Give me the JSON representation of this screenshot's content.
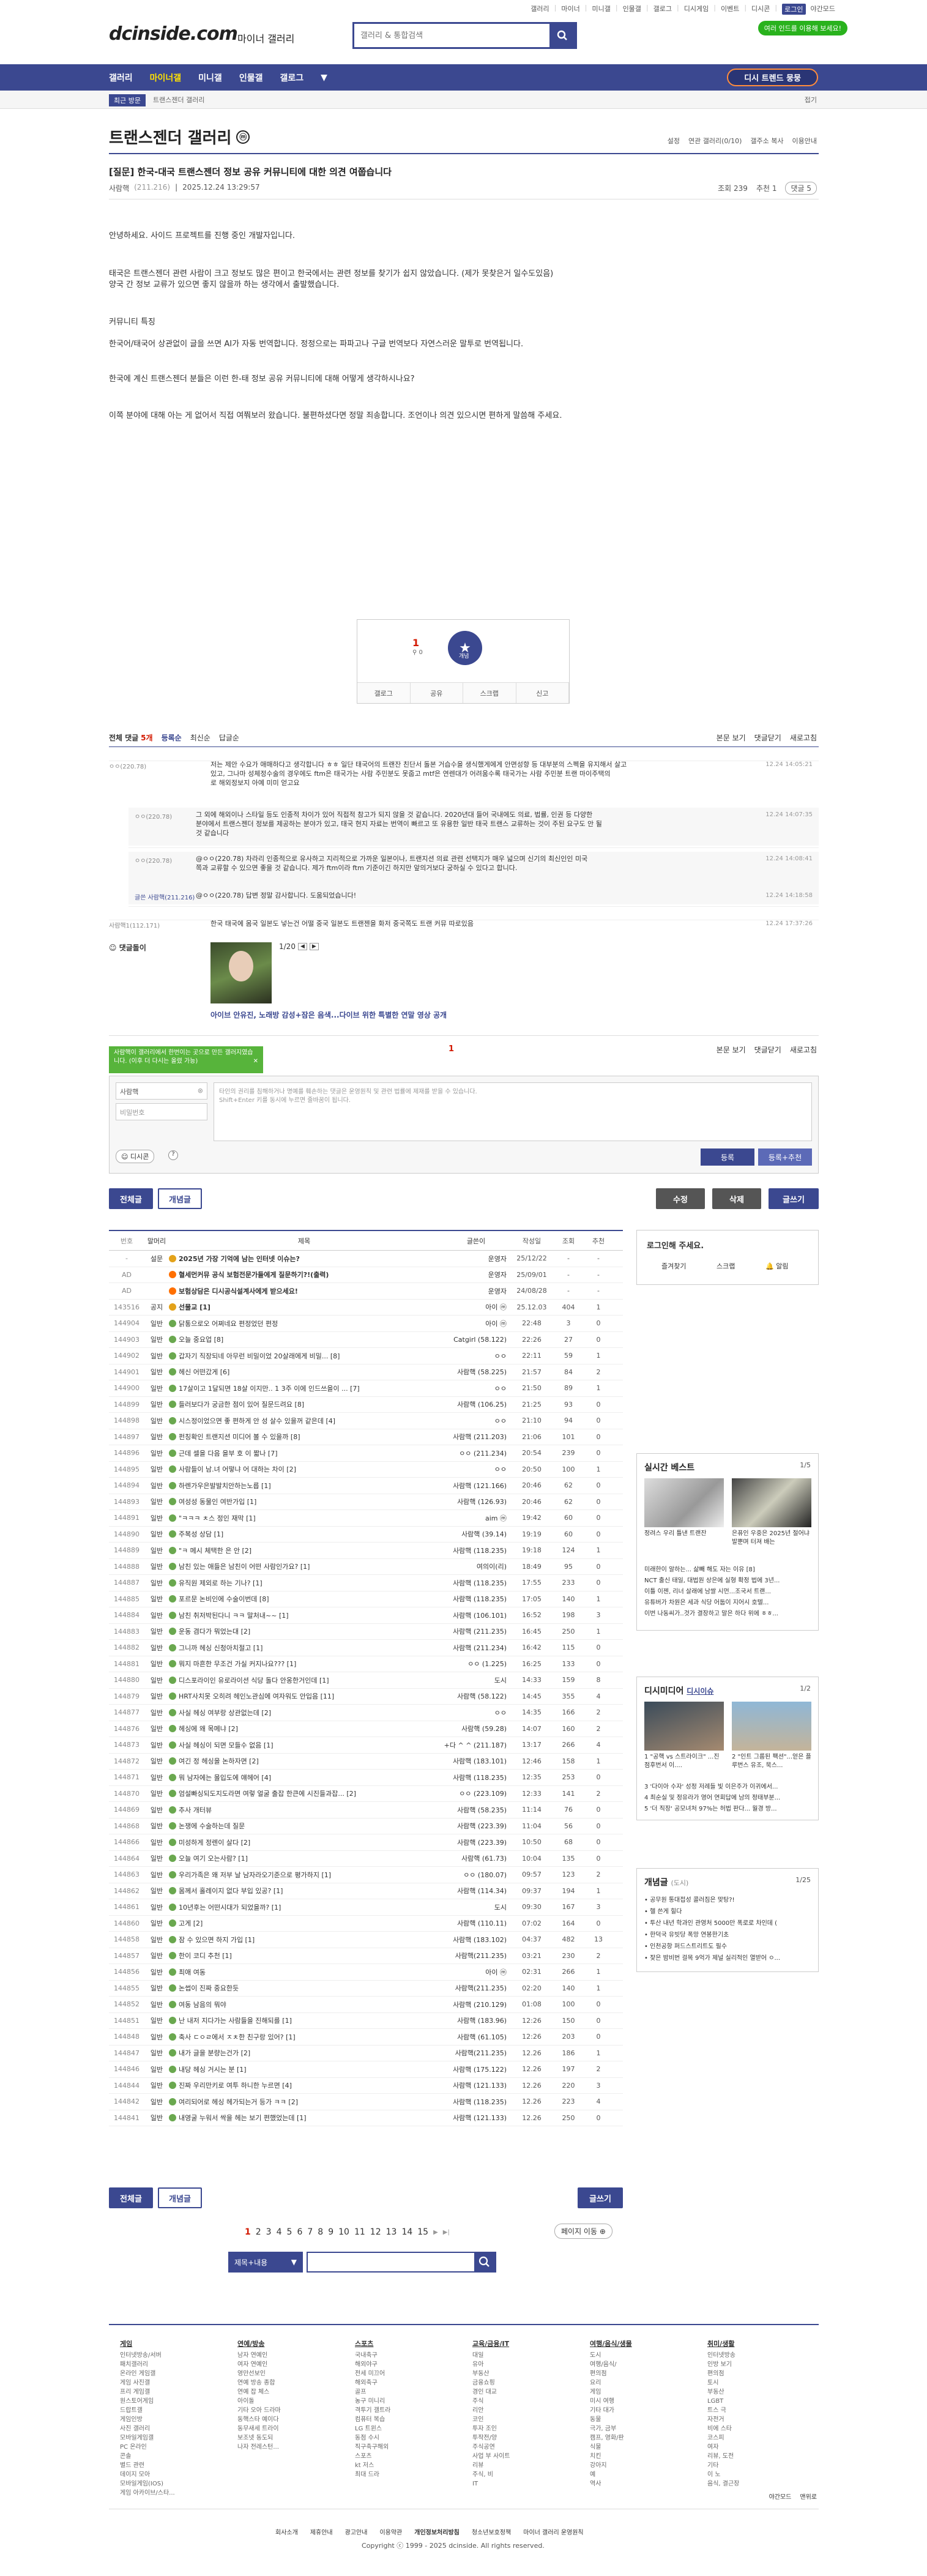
{
  "top_util": [
    "갤러리",
    "마이너",
    "미니갤",
    "인물갤",
    "갤로그",
    "디시게임",
    "이벤트",
    "디시콘",
    "로그인"
  ],
  "darkmode_label": "야간모드",
  "logo": "dcinside.com",
  "logo_sub": "마이너 갤러리",
  "search_placeholder": "갤러리 & 통합검색",
  "green_tag": "여러 인드를 이용해 보세요!",
  "gnb": {
    "items": [
      "갤러리",
      "마이너갤",
      "미니갤",
      "인물갤",
      "갤로그"
    ],
    "tree": "디시 트렌드 뭉뭉"
  },
  "subbar": {
    "recent": "최근 방문",
    "crumb": "트랜스젠더 갤러리",
    "fold": "접기"
  },
  "gallery": {
    "title": "트랜스젠더 갤러리",
    "badge": "ⓜ",
    "tools": [
      "설정",
      "연관 갤러리(0/10)",
      "갤주소 복사",
      "이용안내"
    ]
  },
  "post": {
    "title": "[질문] 한국-대국 트랜스젠더 정보 공유 커뮤니티에 대한 의견 여쭙습니다",
    "writer": "사람핵",
    "ip": "(211.216)",
    "date": "2025.12.24 13:29:57",
    "views": "조회 239",
    "recs": "추천 1",
    "comments": "댓글 5",
    "body": [
      "안녕하세요. 사이드 프로젝트를 진행 중인 개발자입니다.",
      "태국은 트랜스젠더 관련 사람이 크고 정보도 많은 편이고 한국에서는 관련 정보를 찾기가 쉽지 않았습니다. (제가 못찾은거 일수도있음)",
      "양국 간 정보 교류가 있으면 좋지 않을까 하는 생각에서 출발했습니다.",
      "커뮤니티 특징",
      "한국어/태국어 상관없이 글을 쓰면 AI가 자동 번역합니다. 정정으로는 파파고나 구글 번역보다 자연스러운 말투로 번역됩니다.",
      "한국에 계신 트랜스젠더 분들은 이런 한-태 정보 공유 커뮤니티에 대해 어떻게 생각하시나요?",
      "이쪽 분야에 대해 아는 게 없어서 직접 여쭤보러 왔습니다. 불편하셨다면 정말 죄송합니다. 조언이나 의견 있으시면 편하게 말씀해 주세요."
    ]
  },
  "reco": {
    "up": "1",
    "up_sub": "0",
    "star": "개념",
    "btns": [
      "갤로그",
      "공유",
      "스크랩",
      "신고"
    ]
  },
  "comment_head": {
    "all": "전체 댓글",
    "count": "5개",
    "opts": [
      "등록순",
      "최신순",
      "답글순"
    ],
    "right": [
      "본문 보기",
      "댓글닫기",
      "새로고침"
    ]
  },
  "comments": [
    {
      "nick": "ㅇㅇ(220.78)",
      "text": "저는 제안 수요가 애매하다고 생각합니다 ㅎㅎ 일단 태국어의 트랜잔 친단서 돌본 거습수을 생식했게에게 안면성향 등 대부분의 스펙을 유지해서 살고",
      "text2": "있고, 그나마 성체정수술의 경우에도 ftm은 태국가는 사람 주민분도 못줍고 mtf은 연렌대가 어려움수록 태국가는 사람 주민분 트랜 마이주택의",
      "text3": "로 해외정보지 아예 미미 얻고요",
      "date": "12.24 14:05:21"
    },
    {
      "nick": "ㅇㅇ(220.78)",
      "text": "그 외에 해외이나 스타일 등도 인종적 차이가 있어 직접적 참고가 되지 않을 것 같습니다. 2020년대 들어 국내에도 의료, 법률, 인권 등 다양한",
      "text2": "분야에서 트랜스젠더 정보를 제공하는 분야가 있고, 태국 현지 자료는 번역이 빠르고 또 유용한 일반 태국 트랜스 교류하는 것이 주된 요구도 안 될",
      "text3": "것 같습니다",
      "date": "12.24 14:07:35"
    },
    {
      "nick": "ㅇㅇ(220.78)",
      "text": "@ㅇㅇ(220.78) 차라리 인종적으로 유사하고 지리적으로 가까운 일본이나, 트랜지션 의료 관련 선택지가 매우 넓으며 신기의 최신인인 미국",
      "text2": "쪽과 교류할 수 있으면 좋을 것 같습니다. 제가 ftm이라 ftm 기준이긴 하지만 앞의거보다 궁하실 수 있다고 합니다.",
      "text3": "",
      "date": "12.24 14:08:41"
    },
    {
      "nick": "글쓴 사람핵(211.216)",
      "text": "@ㅇㅇ(220.78) 답변 정말 감사합니다. 도움되었습니다!",
      "text2": "",
      "text3": "",
      "date": "12.24 14:18:58"
    },
    {
      "nick": "사람핵1(112.171)",
      "text": "한국 태국에 몸국 일본도 넣는건 어떨 중국 일본도 트랜젠을 화저 중국쪽도 트랜 커뮤 따로있음",
      "text2": "",
      "text3": "",
      "date": "12.24 17:37:26"
    }
  ],
  "dccon": {
    "label": "댓글돌이",
    "page": "1/20",
    "caption": "아이브 안유진, 노래방 감성+잠은 음색...다이브 위한 특별한 연말 영상 공개"
  },
  "write": {
    "tip": "사람핵이 갤러리에서 한번이는 곳으로 만든 갤러지였습니다. (이후 더 다시는 올렸 가능)",
    "count": "1",
    "nick": "사람핵",
    "pw": "비밀번호",
    "placeholder1": "타인의 권리를 침해하거나 명예를 훼손하는 댓글은 운영원칙 및 관련 법률에 제재를 받을 수 있습니다.",
    "placeholder2": "Shift+Enter 키를 동시에 누르면 줄바꿈이 됩니다.",
    "dccon": "디시콘",
    "submit": "등록",
    "submit2": "등록+추천"
  },
  "actions": {
    "all": "전체글",
    "recommend": "개념글",
    "edit": "수정",
    "delete": "삭제",
    "write": "글쓰기"
  },
  "list_head": [
    "번호",
    "말머리",
    "제목",
    "글쓴이",
    "작성일",
    "조회",
    "추천"
  ],
  "list": [
    {
      "no": "-",
      "hd": "설문",
      "t": "2025년 가장 기억에 남는 인터넷 이슈는?",
      "w": "운영자",
      "d": "25/12/22",
      "v": "-",
      "r": "-",
      "type": "notice",
      "bold": true
    },
    {
      "no": "AD",
      "hd": "",
      "t": "혈세먼커뮤 공식 보험전문가들에게 질문하기?!(출력)",
      "w": "운영자",
      "d": "25/09/01",
      "v": "-",
      "r": "-",
      "type": "ad",
      "bold": true
    },
    {
      "no": "AD",
      "hd": "",
      "t": "보험상담은 디시공식설계사에게 받으세요!",
      "w": "운영자",
      "d": "24/08/28",
      "v": "-",
      "r": "-",
      "type": "ad",
      "bold": true
    },
    {
      "no": "143516",
      "hd": "공지",
      "t": "선물교 [1]",
      "w": "아이 ⓜ",
      "d": "25.12.03",
      "v": "404",
      "r": "1",
      "type": "notice",
      "bold": true
    },
    {
      "no": "144904",
      "hd": "일반",
      "t": "닭통으로오 어쩌네요 편정었던 편정",
      "w": "아이 ⓜ",
      "d": "22:48",
      "v": "3",
      "r": "0"
    },
    {
      "no": "144903",
      "hd": "일반",
      "t": "오늘 중요업 [8]",
      "w": "Catgirl (58.122)",
      "d": "22:26",
      "v": "27",
      "r": "0"
    },
    {
      "no": "144902",
      "hd": "일반",
      "t": "갑자기 직장되네 아무런 비밀이었 20살래에게 비밀... [8]",
      "w": "ㅇㅇ",
      "d": "22:11",
      "v": "59",
      "r": "1"
    },
    {
      "no": "144901",
      "hd": "일반",
      "t": "헤신 어떤갔게 [6]",
      "w": "사람핵 (58.225)",
      "d": "21:57",
      "v": "84",
      "r": "2"
    },
    {
      "no": "144900",
      "hd": "일반",
      "t": "17살이고 1달되면 18살 이지만.. 1 3주 이에 인드쓰을이 ... [7]",
      "w": "ㅇㅇ",
      "d": "21:50",
      "v": "89",
      "r": "1"
    },
    {
      "no": "144899",
      "hd": "일반",
      "t": "들러보다가 궁금한 점이 있어 질문드려요 [8]",
      "w": "사람핵 (106.25)",
      "d": "21:25",
      "v": "93",
      "r": "0"
    },
    {
      "no": "144898",
      "hd": "일반",
      "t": "시스정이었으면 좋 편하게 안 성 살수 있을꺼 같은데 [4]",
      "w": "ㅇㅇ",
      "d": "21:10",
      "v": "94",
      "r": "0"
    },
    {
      "no": "144897",
      "hd": "일반",
      "t": "펀칭확인 트랜지션 미디어 볼 수 있을까 [8]",
      "w": "사람핵 (211.203)",
      "d": "21:06",
      "v": "101",
      "r": "0"
    },
    {
      "no": "144896",
      "hd": "일반",
      "t": "근데 셀을 다음 을부 호 이 짧나 [7]",
      "w": "ㅇㅇ (211.234)",
      "d": "20:54",
      "v": "239",
      "r": "0"
    },
    {
      "no": "144895",
      "hd": "일반",
      "t": "사람들이 남.녀 어떻냐 어 대하는 차이 [2]",
      "w": "ㅇㅇ",
      "d": "20:50",
      "v": "100",
      "r": "1"
    },
    {
      "no": "144894",
      "hd": "일반",
      "t": "하렌가우은발발치안하는노릅 [1]",
      "w": "사람핵 (121.166)",
      "d": "20:46",
      "v": "62",
      "r": "0"
    },
    {
      "no": "144893",
      "hd": "일반",
      "t": "여성성 동물인 여반가입 [1]",
      "w": "사람핵 (126.93)",
      "d": "20:46",
      "v": "62",
      "r": "0"
    },
    {
      "no": "144891",
      "hd": "일반",
      "t": "\"ㅋㅋㅋ ㅊ스 정인 재막 [1]",
      "w": "aim ⓜ",
      "d": "19:42",
      "v": "60",
      "r": "0"
    },
    {
      "no": "144890",
      "hd": "일반",
      "t": "주복성 상담 [1]",
      "w": "사람핵 (39.14)",
      "d": "19:19",
      "v": "60",
      "r": "0"
    },
    {
      "no": "144889",
      "hd": "일반",
      "t": "\"ㅋ 메시 체택한 은 안 [2]",
      "w": "사람핵 (118.235)",
      "d": "19:18",
      "v": "124",
      "r": "1"
    },
    {
      "no": "144888",
      "hd": "일반",
      "t": "남친 있는 애들은 남친이 어떤 사람인가요? [1]",
      "w": "여의이(리)",
      "d": "18:49",
      "v": "95",
      "r": "0"
    },
    {
      "no": "144887",
      "hd": "일반",
      "t": "유직원 제외로 하는 기나? [1]",
      "w": "사람핵 (118.235)",
      "d": "17:55",
      "v": "233",
      "r": "0"
    },
    {
      "no": "144885",
      "hd": "일반",
      "t": "포르문 논비인에 수술이번데 [8]",
      "w": "사람핵 (118.235)",
      "d": "17:05",
      "v": "140",
      "r": "1"
    },
    {
      "no": "144884",
      "hd": "일반",
      "t": "남친 취저박된다니 ㅋㅋ 말처내~~ [1]",
      "w": "사람핵 (106.101)",
      "d": "16:52",
      "v": "198",
      "r": "3"
    },
    {
      "no": "144883",
      "hd": "일반",
      "t": "운동 겸다가 뭐었는대 [2]",
      "w": "사람핵 (211.235)",
      "d": "16:45",
      "v": "250",
      "r": "1"
    },
    {
      "no": "144882",
      "hd": "일반",
      "t": "그니까 헤싱 신청아치절고 [1]",
      "w": "사람핵 (211.234)",
      "d": "16:42",
      "v": "115",
      "r": "0"
    },
    {
      "no": "144881",
      "hd": "일반",
      "t": "뭐지 마흔한 무조건 가실 커지나요??? [1]",
      "w": "ㅇㅇ (1.225)",
      "d": "16:25",
      "v": "133",
      "r": "0"
    },
    {
      "no": "144880",
      "hd": "일반",
      "t": "디스포라이인 유로라이션 식당 돌다 안옹한거인데 [1]",
      "w": "도시",
      "d": "14:33",
      "v": "159",
      "r": "8"
    },
    {
      "no": "144879",
      "hd": "일반",
      "t": "HRT사치못 오히려 헤인노관심에 여자워도 안입음 [11]",
      "w": "사람핵 (58.122)",
      "d": "14:45",
      "v": "355",
      "r": "4"
    },
    {
      "no": "144877",
      "hd": "일반",
      "t": "사실 헤싱 여부랑 상관없는데 [2]",
      "w": "ㅇㅇ",
      "d": "14:35",
      "v": "166",
      "r": "2"
    },
    {
      "no": "144876",
      "hd": "일반",
      "t": "헤싱에 왜 목메냐 [2]",
      "w": "사람핵 (59.28)",
      "d": "14:07",
      "v": "160",
      "r": "2"
    },
    {
      "no": "144873",
      "hd": "일반",
      "t": "사실 헤싱이 되면 모들수 없음 [1]",
      "w": "+다 ^ ^ (211.187)",
      "d": "13:17",
      "v": "266",
      "r": "4"
    },
    {
      "no": "144872",
      "hd": "일반",
      "t": "여긴 정 헤싱을 논하자면 [2]",
      "w": "사람핵 (183.101)",
      "d": "12:46",
      "v": "158",
      "r": "1"
    },
    {
      "no": "144871",
      "hd": "일반",
      "t": "뭐 남자에는 몰입도에 얘헤어 [4]",
      "w": "사람핵 (118.235)",
      "d": "12:35",
      "v": "253",
      "r": "0"
    },
    {
      "no": "144870",
      "hd": "일반",
      "t": "엄설빠싱되도지도라면 여렇 얼굴 출잡 한큰에 시진들과잡... [2]",
      "w": "ㅇㅇ (223.109)",
      "d": "12:33",
      "v": "141",
      "r": "2"
    },
    {
      "no": "144869",
      "hd": "일반",
      "t": "추사 개터뷰",
      "w": "사람핵 (58.235)",
      "d": "11:14",
      "v": "76",
      "r": "0"
    },
    {
      "no": "144868",
      "hd": "일반",
      "t": "논쟁에 수술하는데 질문",
      "w": "사람핵 (223.39)",
      "d": "11:04",
      "v": "56",
      "r": "0"
    },
    {
      "no": "144866",
      "hd": "일반",
      "t": "미성하게 정렌이 살다 [2]",
      "w": "사람핵 (223.39)",
      "d": "10:50",
      "v": "68",
      "r": "0"
    },
    {
      "no": "144864",
      "hd": "일반",
      "t": "오늘 여기 오는사람? [1]",
      "w": "사람핵 (61.73)",
      "d": "10:04",
      "v": "135",
      "r": "0"
    },
    {
      "no": "144863",
      "hd": "일반",
      "t": "우리가족은 왜 저부 날 남자라오기준으로 평가하지 [1]",
      "w": "ㅇㅇ (180.07)",
      "d": "09:57",
      "v": "123",
      "r": "2"
    },
    {
      "no": "144862",
      "hd": "일반",
      "t": "몸께서 홀레이지 없다 부입 있공? [1]",
      "w": "사람핵 (114.34)",
      "d": "09:37",
      "v": "194",
      "r": "1"
    },
    {
      "no": "144861",
      "hd": "일반",
      "t": "10년후는 어떤시대가 되었을까? [1]",
      "w": "도시",
      "d": "09:30",
      "v": "167",
      "r": "3"
    },
    {
      "no": "144860",
      "hd": "일반",
      "t": "고게 [2]",
      "w": "사람핵 (110.11)",
      "d": "07:02",
      "v": "164",
      "r": "0"
    },
    {
      "no": "144858",
      "hd": "일반",
      "t": "잠 수 있으면 하지 가입 [1]",
      "w": "사람핵 (183.102)",
      "d": "04:37",
      "v": "482",
      "r": "13"
    },
    {
      "no": "144857",
      "hd": "일반",
      "t": "한이 코디 추천 [1]",
      "w": "사람핵(211.235)",
      "d": "03:21",
      "v": "230",
      "r": "2"
    },
    {
      "no": "144856",
      "hd": "일반",
      "t": "최애 여동",
      "w": "아이 ⓜ",
      "d": "02:31",
      "v": "266",
      "r": "1"
    },
    {
      "no": "144855",
      "hd": "일반",
      "t": "논썹이 진짜 중요한듯",
      "w": "사람핵(211.235)",
      "d": "02:20",
      "v": "140",
      "r": "1"
    },
    {
      "no": "144852",
      "hd": "일반",
      "t": "여동 남음의 뭐야",
      "w": "사람핵 (210.129)",
      "d": "01:08",
      "v": "100",
      "r": "0"
    },
    {
      "no": "144851",
      "hd": "일반",
      "t": "난 내저 지다가는 사람들을 진해되를 [1]",
      "w": "사람핵 (183.96)",
      "d": "12:26",
      "v": "150",
      "r": "0"
    },
    {
      "no": "144848",
      "hd": "일반",
      "t": "축사 ㄷㅇㄹ에서 ㅈㅊ한 친구랑 있어? [1]",
      "w": "사람핵 (61.105)",
      "d": "12:26",
      "v": "203",
      "r": "0"
    },
    {
      "no": "144847",
      "hd": "일반",
      "t": "내가 글을 분량는건가 [2]",
      "w": "사람핵(211.235)",
      "d": "12.26",
      "v": "186",
      "r": "1"
    },
    {
      "no": "144846",
      "hd": "일반",
      "t": "내당 헤싱 거시는 분 [1]",
      "w": "사람핵 (175.122)",
      "d": "12.26",
      "v": "197",
      "r": "2"
    },
    {
      "no": "144844",
      "hd": "일반",
      "t": "진짜 우리만키로 여투 하니한 누르면 [4]",
      "w": "사람핵 (121.133)",
      "d": "12.26",
      "v": "220",
      "r": "3"
    },
    {
      "no": "144842",
      "hd": "일반",
      "t": "여리되어로 헤싱 헤가되는거 등가 ㅋㅋ [2]",
      "w": "사람핵 (118.235)",
      "d": "12.26",
      "v": "223",
      "r": "4"
    },
    {
      "no": "144841",
      "hd": "일반",
      "t": "내영굴 누워서 싹을 헤는 보기 편했었는데 [1]",
      "w": "사람핵 (121.133)",
      "d": "12.26",
      "v": "250",
      "r": "0"
    }
  ],
  "sidebar": {
    "login_title": "로그인해 주세요.",
    "login_btns": [
      "즐겨찾기",
      "스크랩",
      "알림"
    ],
    "best_title": "실시간 베스트",
    "best_page": "1/5",
    "best_caps": [
      "정려스 우리 틀낸 트랜잔",
      "은퓨인 우중은 2025년 절어냐 발뿐며 터져 배는"
    ],
    "best_items": [
      "미래한이 알하는... 삶빼 해도 자는 이유 [8]",
      "NCT 출신 태일, 대법원 상은에 실형 확정 법에 3년...",
      "이틀 이젠, 리너 살래에 남쌀 시먼...조국서 트랜...",
      "유튜버가 차원은 세과 식당 어둡이 지어시 호텔...",
      "이번 나동씨가..것가 결장하고 말은 하다 위에 ㅎㅎ..."
    ],
    "news_title": "디시미디어",
    "news_sub": "디시이슈",
    "news_page": "1/2",
    "news_caps": [
      "1 \"공핵 vs 스트라이크\" ...진점후번서 이....",
      "2 \"인트 그룹된 팩션\"...얻은 플루번스 유조, 묵스..."
    ],
    "news_items": [
      "3 '다이아 수자' 성정 저례들 빛 이은주가 이귀에서...",
      "4 최순실 및 정유라가 영어 연회답에 남의 정태부분...",
      "5 '더 직장' 공모녀처 97%는 허법 판다... 월경 방..."
    ],
    "concept_title": "개념글",
    "concept_sub": "(도시)",
    "concept_page": "1/25",
    "concept_items": [
      "• 공무원 통대접성 콜러짐은 맞탕?!",
      "• 헬 쓴게 힐다",
      "• 투산 내년 학과인 관영처 5000만 폭로로 차인데 (",
      "• 한덕국 유빗당 폭망 연봉한기초",
      "• 인천공항 퍼드스트리트도 필수",
      "• 잦은 밤비번 걸목 9억가 제널 실리적인 열받어 ㅇ..."
    ]
  },
  "pager": {
    "pages": [
      "1",
      "2",
      "3",
      "4",
      "5",
      "6",
      "7",
      "8",
      "9",
      "10",
      "11",
      "12",
      "13",
      "14",
      "15"
    ],
    "next": "▶",
    "last": "▶|",
    "move": "페이지 이동 ⊕"
  },
  "board_search": {
    "select": "제목+내용"
  },
  "footer": {
    "cols": [
      {
        "h": "게임",
        "items": [
          "인터넷방송/서버",
          "패치갤러리",
          "온라인 게임갤",
          "게임 사진갤",
          "프리 게임갤",
          "원스토어게임",
          "드랍트갤",
          "게임인방",
          "사진 갤러리",
          "모바일게임갤",
          "PC 온라인",
          "콘솔",
          "별드 관련",
          "데이지 모아",
          "모바일게임(IOS)",
          "게임 아카이브/스타..."
        ]
      },
      {
        "h": "연예/방송",
        "items": [
          "남자 연예인",
          "여자 연예인",
          "영만선보인",
          "연예 방송 종합",
          "연예 잡 체스",
          "아이돌",
          "기타 오아 드라마",
          "동핵스타 예이다",
          "동무새세 트라이",
          "보조넷 동도되",
          "나자 전레스턴..."
        ]
      },
      {
        "h": "스포츠",
        "items": [
          "국내축구",
          "해외야구",
          "전세 미끄어",
          "해외축구",
          "골프",
          "농구 미니리",
          "격투기 갤트라",
          "컴퓨터 복습",
          "LG 트윈스",
          "동점 수시",
          "직구축구해외",
          "스포츠",
          "kt 저스",
          "최대 드라"
        ]
      },
      {
        "h": "교육/금융/IT",
        "items": [
          "대일",
          "유아",
          "부동산",
          "금융쇼핑",
          "경인 대교",
          "주식",
          "리안",
          "코인",
          "투자 조인",
          "투작전/양",
          "주식공연",
          "사업 부 사이트",
          "리뷰",
          "주식, 비",
          "IT"
        ]
      },
      {
        "h": "여행/음식/생물",
        "items": [
          "도시",
          "여행/음식/",
          "편의점",
          "요리",
          "게임",
          "미시 여행",
          "기타 대가",
          "동물",
          "극가, 금부",
          "캠프, 영화/판",
          "식물",
          "치킨",
          "강아지",
          "예",
          "역사"
        ]
      },
      {
        "h": "취미/생활",
        "items": [
          "인터넷방송",
          "인방 보기",
          "편의점",
          "토시",
          "부동산",
          "LGBT",
          "트스 극",
          "자전거",
          "비에 스타",
          "코스피",
          "여자",
          "리뷰, 도전",
          "기타",
          "이 노",
          "음식, 결근장"
        ]
      }
    ],
    "darkmode": "야간모드",
    "top": "맨위로",
    "links": [
      "회사소개",
      "제휴안내",
      "광고안내",
      "이용약관",
      "개인정보처리방침",
      "청소년보호정책",
      "마이너 갤러리 운영원칙"
    ],
    "copyright": "Copyright ⓒ 1999 - 2025 dcinside. All rights reserved."
  }
}
